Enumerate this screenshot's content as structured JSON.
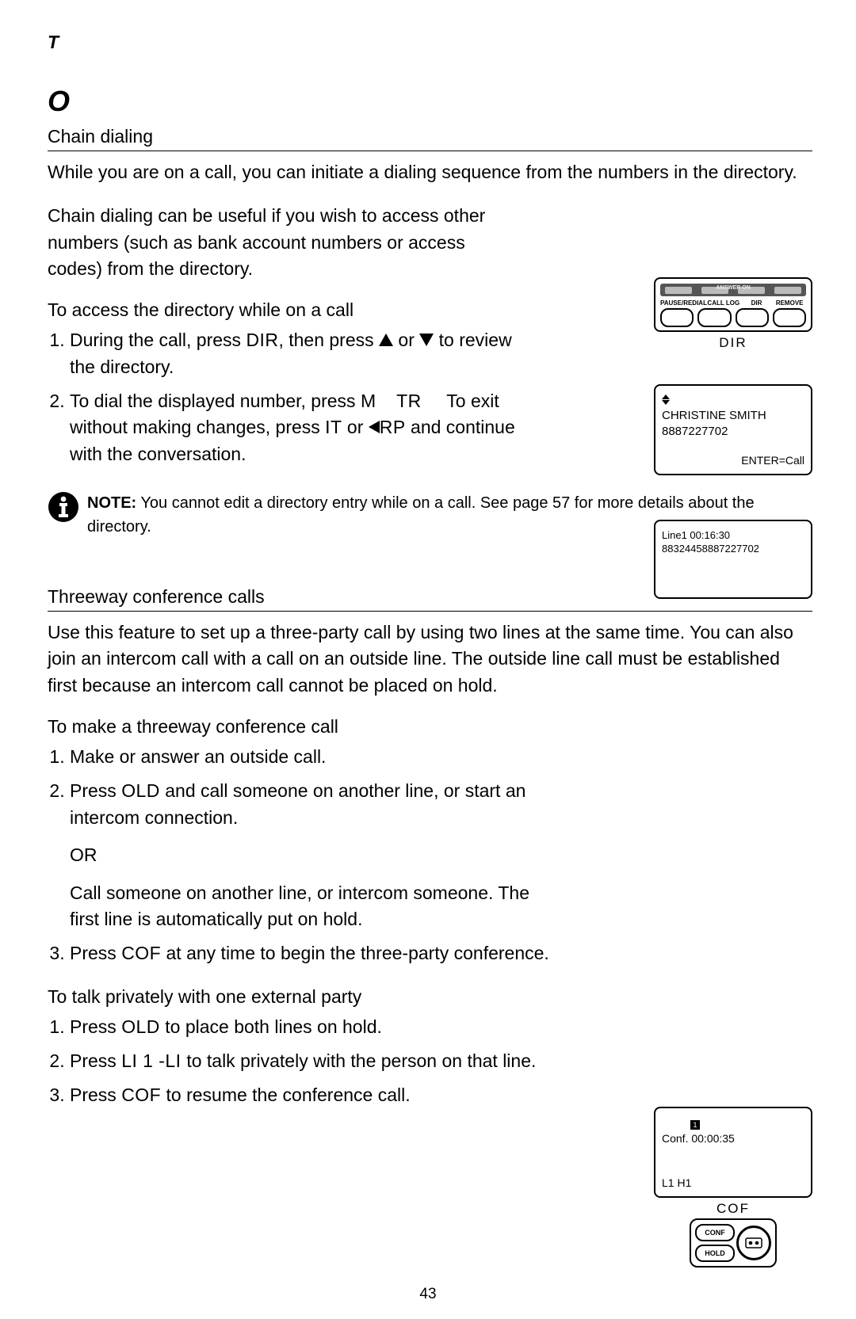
{
  "page": {
    "letter_t": "T",
    "letter_o": "O",
    "number": "43"
  },
  "chain": {
    "heading": "Chain dialing",
    "p1": "While you are on a call, you can initiate a dialing sequence from the numbers in the directory.",
    "p2": "Chain dialing can be useful if you wish to access other numbers (such as bank account numbers or access codes) from the directory.",
    "access_heading": "To access the directory while on a call",
    "step1_a": "During the call, press ",
    "step1_dir": "DIR",
    "step1_b": ", then press ",
    "step1_c": " or ",
    "step1_d": " to review the directory.",
    "step2_a": "To dial the displayed number, press ",
    "step2_m": "M",
    "step2_tr": "TR",
    "step2_b": "  To exit without making changes, press ",
    "step2_it": "IT",
    "step2_c": "  or ",
    "step2_rp": "RP",
    "step2_d": "  and continue with the conversation."
  },
  "note": {
    "label": "NOTE:",
    "text": " You cannot edit a directory entry while on a call. See page 57 for more details about the directory."
  },
  "conf": {
    "heading": "Threeway conference calls",
    "p1": "Use this feature to set up a three-party call by using two lines at the same time. You can also join an intercom call with a call on an outside line. The outside line call must be established first because an intercom call cannot be placed on hold.",
    "make_heading": "To make a threeway conference call",
    "s1": "Make or answer an outside call.",
    "s2_a": "Press ",
    "s2_old": "OLD",
    "s2_b": "  and call someone on another line, or start an intercom connection.",
    "s2_or": "OR",
    "s2_c": "Call someone on another line, or intercom someone. The first line is automatically put on hold.",
    "s3_a": "Press ",
    "s3_cof": "COF",
    "s3_b": "  at any time to begin the three-party conference.",
    "priv_heading": "To talk privately with one external party",
    "p_s1_a": "Press ",
    "p_s1_old": "OLD",
    "p_s1_b": "  to place both lines on hold.",
    "p_s2_a": "Press ",
    "p_s2_li": "LI 1    -LI ",
    "p_s2_b": "     to talk privately with the person on that line.",
    "p_s3_a": "Press ",
    "p_s3_cof": "COF",
    "p_s3_b": "  to resume the conference call."
  },
  "fig_dir": {
    "caption": "DIR",
    "labels": {
      "a": "PAUSE/REDIAL",
      "b": "CALL LOG",
      "c": "DIR",
      "d": "REMOVE"
    },
    "answer_on": "ANSWER ON"
  },
  "lcd1": {
    "name": "CHRISTINE SMITH",
    "number": "8887227702",
    "enter": "ENTER=Call"
  },
  "lcd2": {
    "linetime": "Line1   00:16:30",
    "number": "88324458887227702"
  },
  "lcd3": {
    "conf": "Conf.   00:00:35",
    "l1h1": "L1 H1",
    "caption": "COF",
    "pill_conf": "CONF",
    "pill_hold": "HOLD"
  }
}
